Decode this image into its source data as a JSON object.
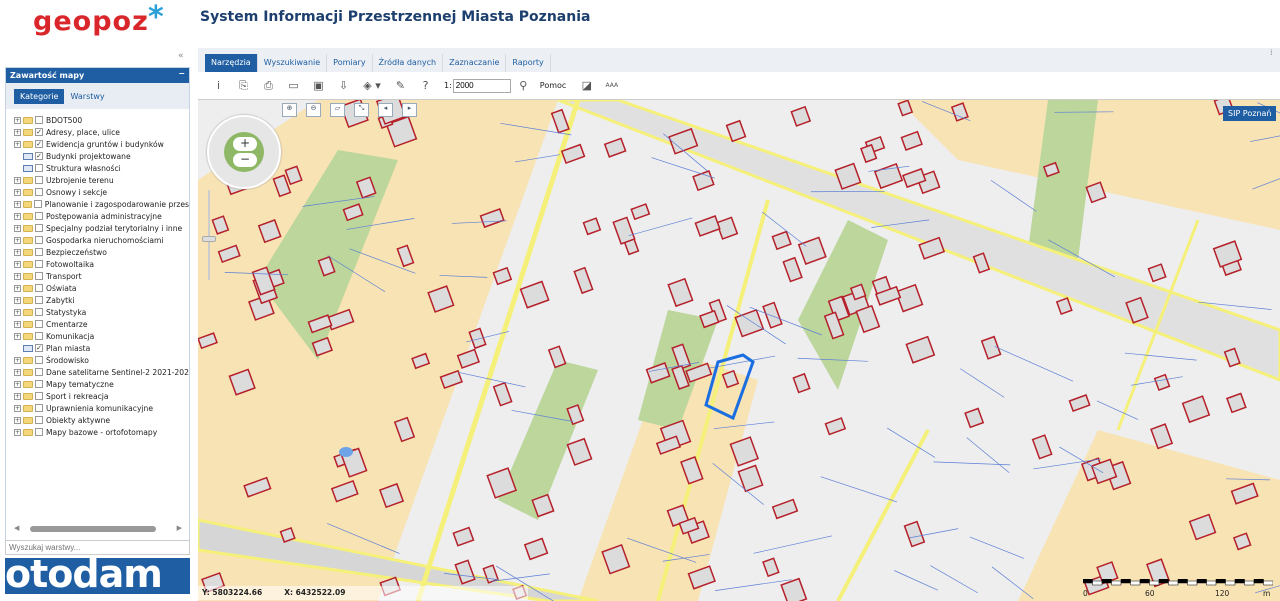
{
  "header": {
    "logo": "geopoz",
    "title": "System Informacji Przestrzennej Miasta Poznania"
  },
  "panel": {
    "title": "Zawartość mapy",
    "minimize": "−",
    "collapse": "«",
    "tabs": [
      {
        "label": "Kategorie",
        "active": true
      },
      {
        "label": "Warstwy",
        "active": false
      }
    ],
    "layers": [
      {
        "label": "BDOT500",
        "checked": false,
        "type": "folder"
      },
      {
        "label": "Adresy, place, ulice",
        "checked": true,
        "type": "folder"
      },
      {
        "label": "Ewidencja gruntów i budynków",
        "checked": true,
        "type": "folder"
      },
      {
        "label": "Budynki projektowane",
        "checked": true,
        "type": "legend"
      },
      {
        "label": "Struktura własności",
        "checked": false,
        "type": "legend"
      },
      {
        "label": "Uzbrojenie terenu",
        "checked": false,
        "type": "folder"
      },
      {
        "label": "Osnowy i sekcje",
        "checked": false,
        "type": "folder"
      },
      {
        "label": "Planowanie i zagospodarowanie przes",
        "checked": false,
        "type": "folder"
      },
      {
        "label": "Postępowania administracyjne",
        "checked": false,
        "type": "folder"
      },
      {
        "label": "Specjalny podział terytorialny i inne",
        "checked": false,
        "type": "folder"
      },
      {
        "label": "Gospodarka nieruchomościami",
        "checked": false,
        "type": "folder"
      },
      {
        "label": "Bezpieczeństwo",
        "checked": false,
        "type": "folder"
      },
      {
        "label": "Fotowoltaika",
        "checked": false,
        "type": "folder"
      },
      {
        "label": "Transport",
        "checked": false,
        "type": "folder"
      },
      {
        "label": "Oświata",
        "checked": false,
        "type": "folder"
      },
      {
        "label": "Zabytki",
        "checked": false,
        "type": "folder"
      },
      {
        "label": "Statystyka",
        "checked": false,
        "type": "folder"
      },
      {
        "label": "Cmentarze",
        "checked": false,
        "type": "folder"
      },
      {
        "label": "Komunikacja",
        "checked": false,
        "type": "folder"
      },
      {
        "label": "Plan miasta",
        "checked": true,
        "type": "legend"
      },
      {
        "label": "Środowisko",
        "checked": false,
        "type": "folder"
      },
      {
        "label": "Dane satelitarne Sentinel-2 2021-202",
        "checked": false,
        "type": "folder"
      },
      {
        "label": "Mapy tematyczne",
        "checked": false,
        "type": "folder"
      },
      {
        "label": "Sport i rekreacja",
        "checked": false,
        "type": "folder"
      },
      {
        "label": "Uprawnienia komunikacyjne",
        "checked": false,
        "type": "folder"
      },
      {
        "label": "Obiekty aktywne",
        "checked": false,
        "type": "folder"
      },
      {
        "label": "Mapy bazowe - ortofotomapy",
        "checked": false,
        "type": "folder"
      }
    ],
    "search_placeholder": "Wyszukaj warstwy..."
  },
  "watermark": "otodom",
  "tabs": [
    {
      "label": "Narzędzia",
      "active": true
    },
    {
      "label": "Wyszukiwanie"
    },
    {
      "label": "Pomiary"
    },
    {
      "label": "Źródła danych"
    },
    {
      "label": "Zaznaczanie"
    },
    {
      "label": "Raporty"
    }
  ],
  "toolbar": {
    "scale_prefix": "1:",
    "scale_value": "2000",
    "help": "Pomoc",
    "font_size": "AAA"
  },
  "map": {
    "sip_button": "SIP Poznań",
    "coord_y": "Y: 5803224.66",
    "coord_x": "X: 6432522.09",
    "scalebar": {
      "labels": [
        "0",
        "60",
        "120",
        "m"
      ]
    }
  },
  "colors": {
    "accent": "#1f5ea3",
    "building": "#b5202a",
    "parcel": "#5b7fd6"
  }
}
